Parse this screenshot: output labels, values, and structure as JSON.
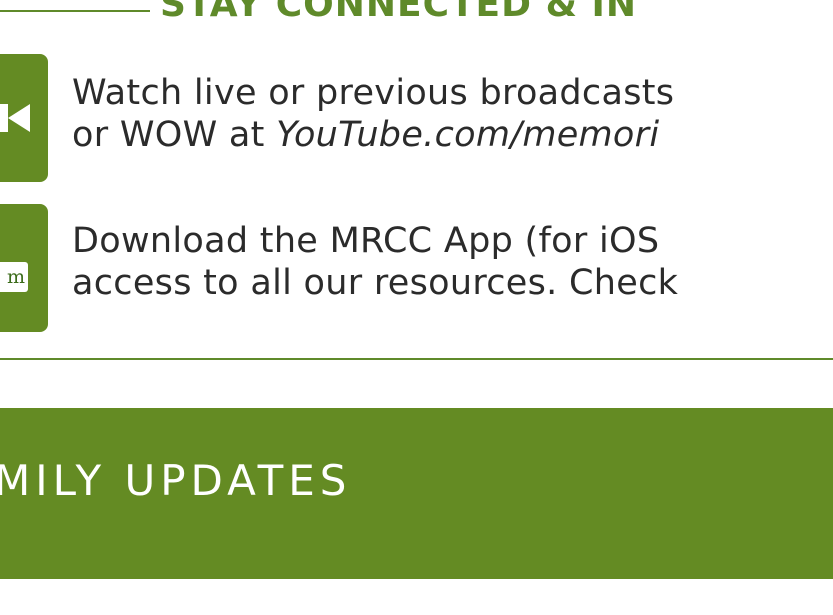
{
  "section": {
    "heading": "STAY CONNECTED & IN"
  },
  "items": [
    {
      "icon": "video-camera-icon",
      "line1": "Watch live or previous broadcasts",
      "line2_prefix": "or WOW at ",
      "line2_link": "YouTube.com/memori"
    },
    {
      "icon": "mobile-app-icon",
      "icon_text": "m",
      "line1": "Download the MRCC App (for iOS",
      "line2": "access to all our resources. Check"
    }
  ],
  "band": {
    "title": "MILY UPDATES"
  },
  "colors": {
    "accent": "#648b23",
    "heading": "#5f8a2a",
    "text": "#2b2b2b"
  }
}
